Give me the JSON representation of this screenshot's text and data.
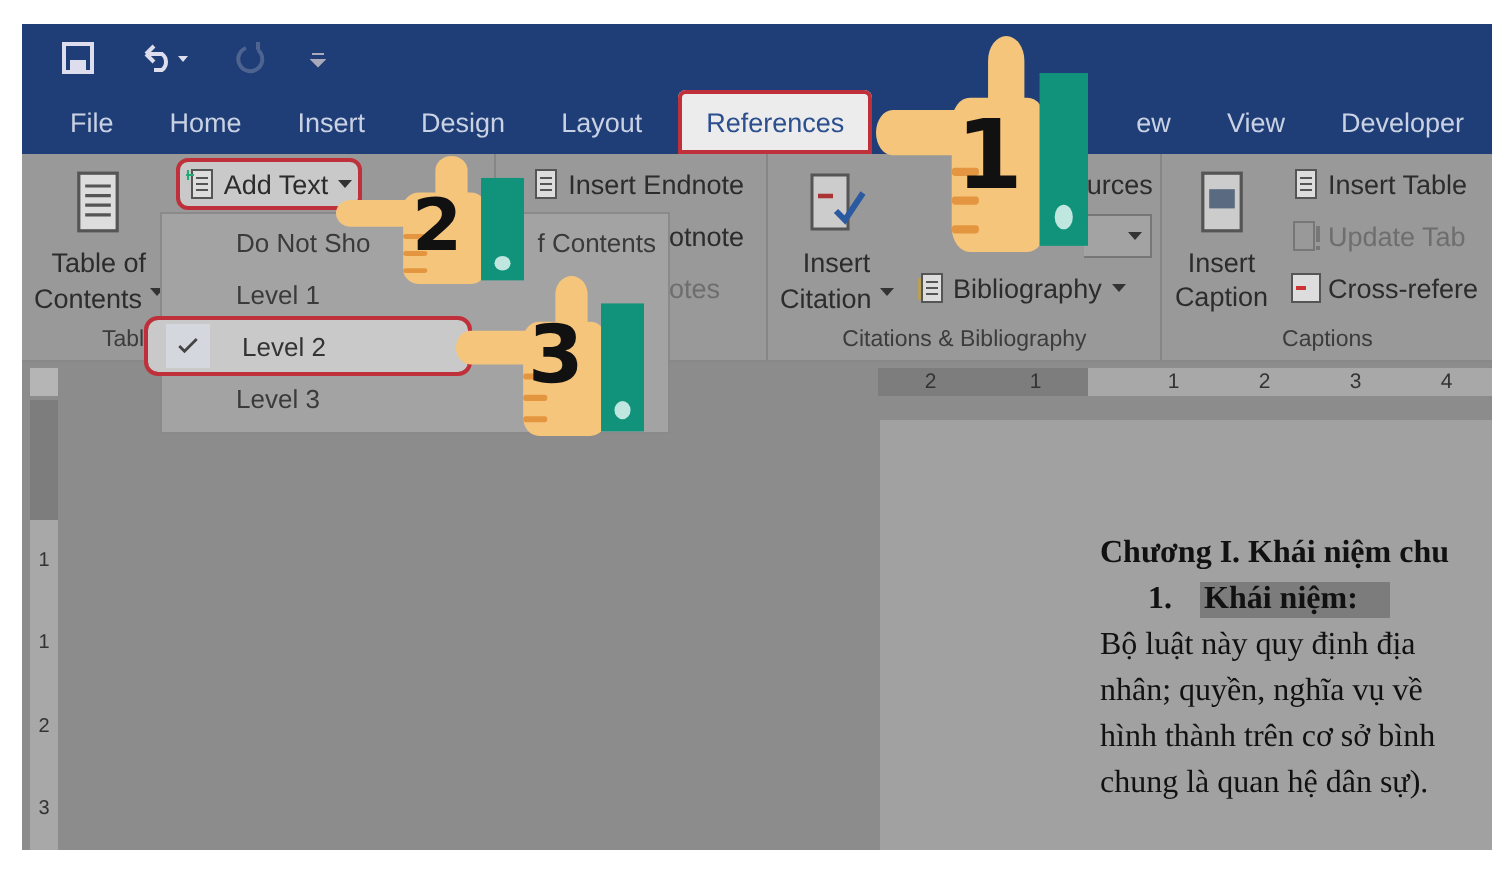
{
  "quick_access": {
    "redo_disabled": true
  },
  "tabs": [
    {
      "label": "File",
      "selected": false
    },
    {
      "label": "Home",
      "selected": false
    },
    {
      "label": "Insert",
      "selected": false
    },
    {
      "label": "Design",
      "selected": false
    },
    {
      "label": "Layout",
      "selected": false
    },
    {
      "label": "References",
      "selected": true
    },
    {
      "label": "ew",
      "selected": false
    },
    {
      "label": "View",
      "selected": false
    },
    {
      "label": "Developer",
      "selected": false
    }
  ],
  "ribbon": {
    "toc": {
      "big_button": [
        "Table of",
        "Contents"
      ],
      "add_text": {
        "label": "Add Text",
        "highlighted": true
      },
      "group_label": "Tabl"
    },
    "footnotes": {
      "items": [
        {
          "label": "Insert Endnote",
          "disabled": false,
          "kind": "endnote"
        },
        {
          "label": "otnote",
          "disabled": false,
          "kind": "plain"
        },
        {
          "label": "otes",
          "disabled": true,
          "kind": "plain"
        }
      ]
    },
    "citations": {
      "big_button": [
        "Insert",
        "Citation"
      ],
      "sources": "urces",
      "bibliography": "Bibliography",
      "group_label": "Citations & Bibliography"
    },
    "captions": {
      "big_button": [
        "Insert",
        "Caption"
      ],
      "items": [
        {
          "label": "Insert Table",
          "disabled": false,
          "kind": "table"
        },
        {
          "label": "Update Tab",
          "disabled": true,
          "kind": "update"
        },
        {
          "label": "Cross-refere",
          "disabled": false,
          "kind": "cross"
        }
      ],
      "group_label": "Captions"
    }
  },
  "dropdown": {
    "items": [
      {
        "label": "Do Not Sho",
        "label_tail": "f Contents",
        "selected": false
      },
      {
        "label": "Level 1",
        "selected": false
      },
      {
        "label": "Level 2",
        "selected": true
      },
      {
        "label": "Level 3",
        "selected": false
      }
    ]
  },
  "ruler": {
    "left_marks": [
      "2",
      "1"
    ],
    "right_marks": [
      "1",
      "2",
      "3",
      "4"
    ],
    "vertical_marks": [
      "1",
      "1",
      "2",
      "3"
    ]
  },
  "document": {
    "heading": "Chương I. Khái niệm chu",
    "list_number": "1.",
    "list_item": "Khái niệm:",
    "lines": [
      "Bộ luật này quy định địa",
      "nhân; quyền, nghĩa vụ về",
      "hình thành trên cơ sở bình",
      "chung là quan hệ dân sự)."
    ]
  },
  "callouts": [
    {
      "number": "1"
    },
    {
      "number": "2"
    },
    {
      "number": "3"
    }
  ]
}
